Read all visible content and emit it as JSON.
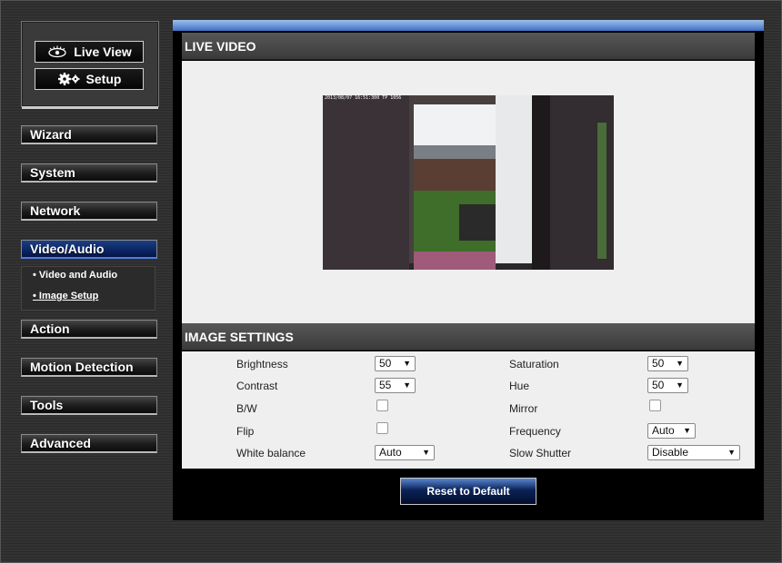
{
  "mode": {
    "live_view_label": "Live View",
    "setup_label": "Setup"
  },
  "nav": {
    "items": [
      {
        "label": "Wizard",
        "active": false
      },
      {
        "label": "System",
        "active": false
      },
      {
        "label": "Network",
        "active": false
      },
      {
        "label": "Video/Audio",
        "active": true
      },
      {
        "label": "Action",
        "active": false
      },
      {
        "label": "Motion Detection",
        "active": false
      },
      {
        "label": "Tools",
        "active": false
      },
      {
        "label": "Advanced",
        "active": false
      }
    ],
    "submenu": [
      {
        "label": "Video and Audio",
        "current": false
      },
      {
        "label": "Image Setup",
        "current": true
      }
    ]
  },
  "live_video": {
    "title": "LIVE VIDEO",
    "overlay_text": "2013/08/07 16:51:300 TP 1056"
  },
  "image_settings": {
    "title": "IMAGE SETTINGS",
    "brightness": {
      "label": "Brightness",
      "value": "50"
    },
    "contrast": {
      "label": "Contrast",
      "value": "55"
    },
    "bw": {
      "label": "B/W",
      "checked": false
    },
    "flip": {
      "label": "Flip",
      "checked": false
    },
    "white_balance": {
      "label": "White balance",
      "value": "Auto"
    },
    "saturation": {
      "label": "Saturation",
      "value": "50"
    },
    "hue": {
      "label": "Hue",
      "value": "50"
    },
    "mirror": {
      "label": "Mirror",
      "checked": false
    },
    "frequency": {
      "label": "Frequency",
      "value": "Auto"
    },
    "slow_shutter": {
      "label": "Slow Shutter",
      "value": "Disable"
    }
  },
  "actions": {
    "reset_label": "Reset to Default"
  },
  "colors": {
    "accent_blue": "#0c2462",
    "panel_bg": "#efefef"
  }
}
